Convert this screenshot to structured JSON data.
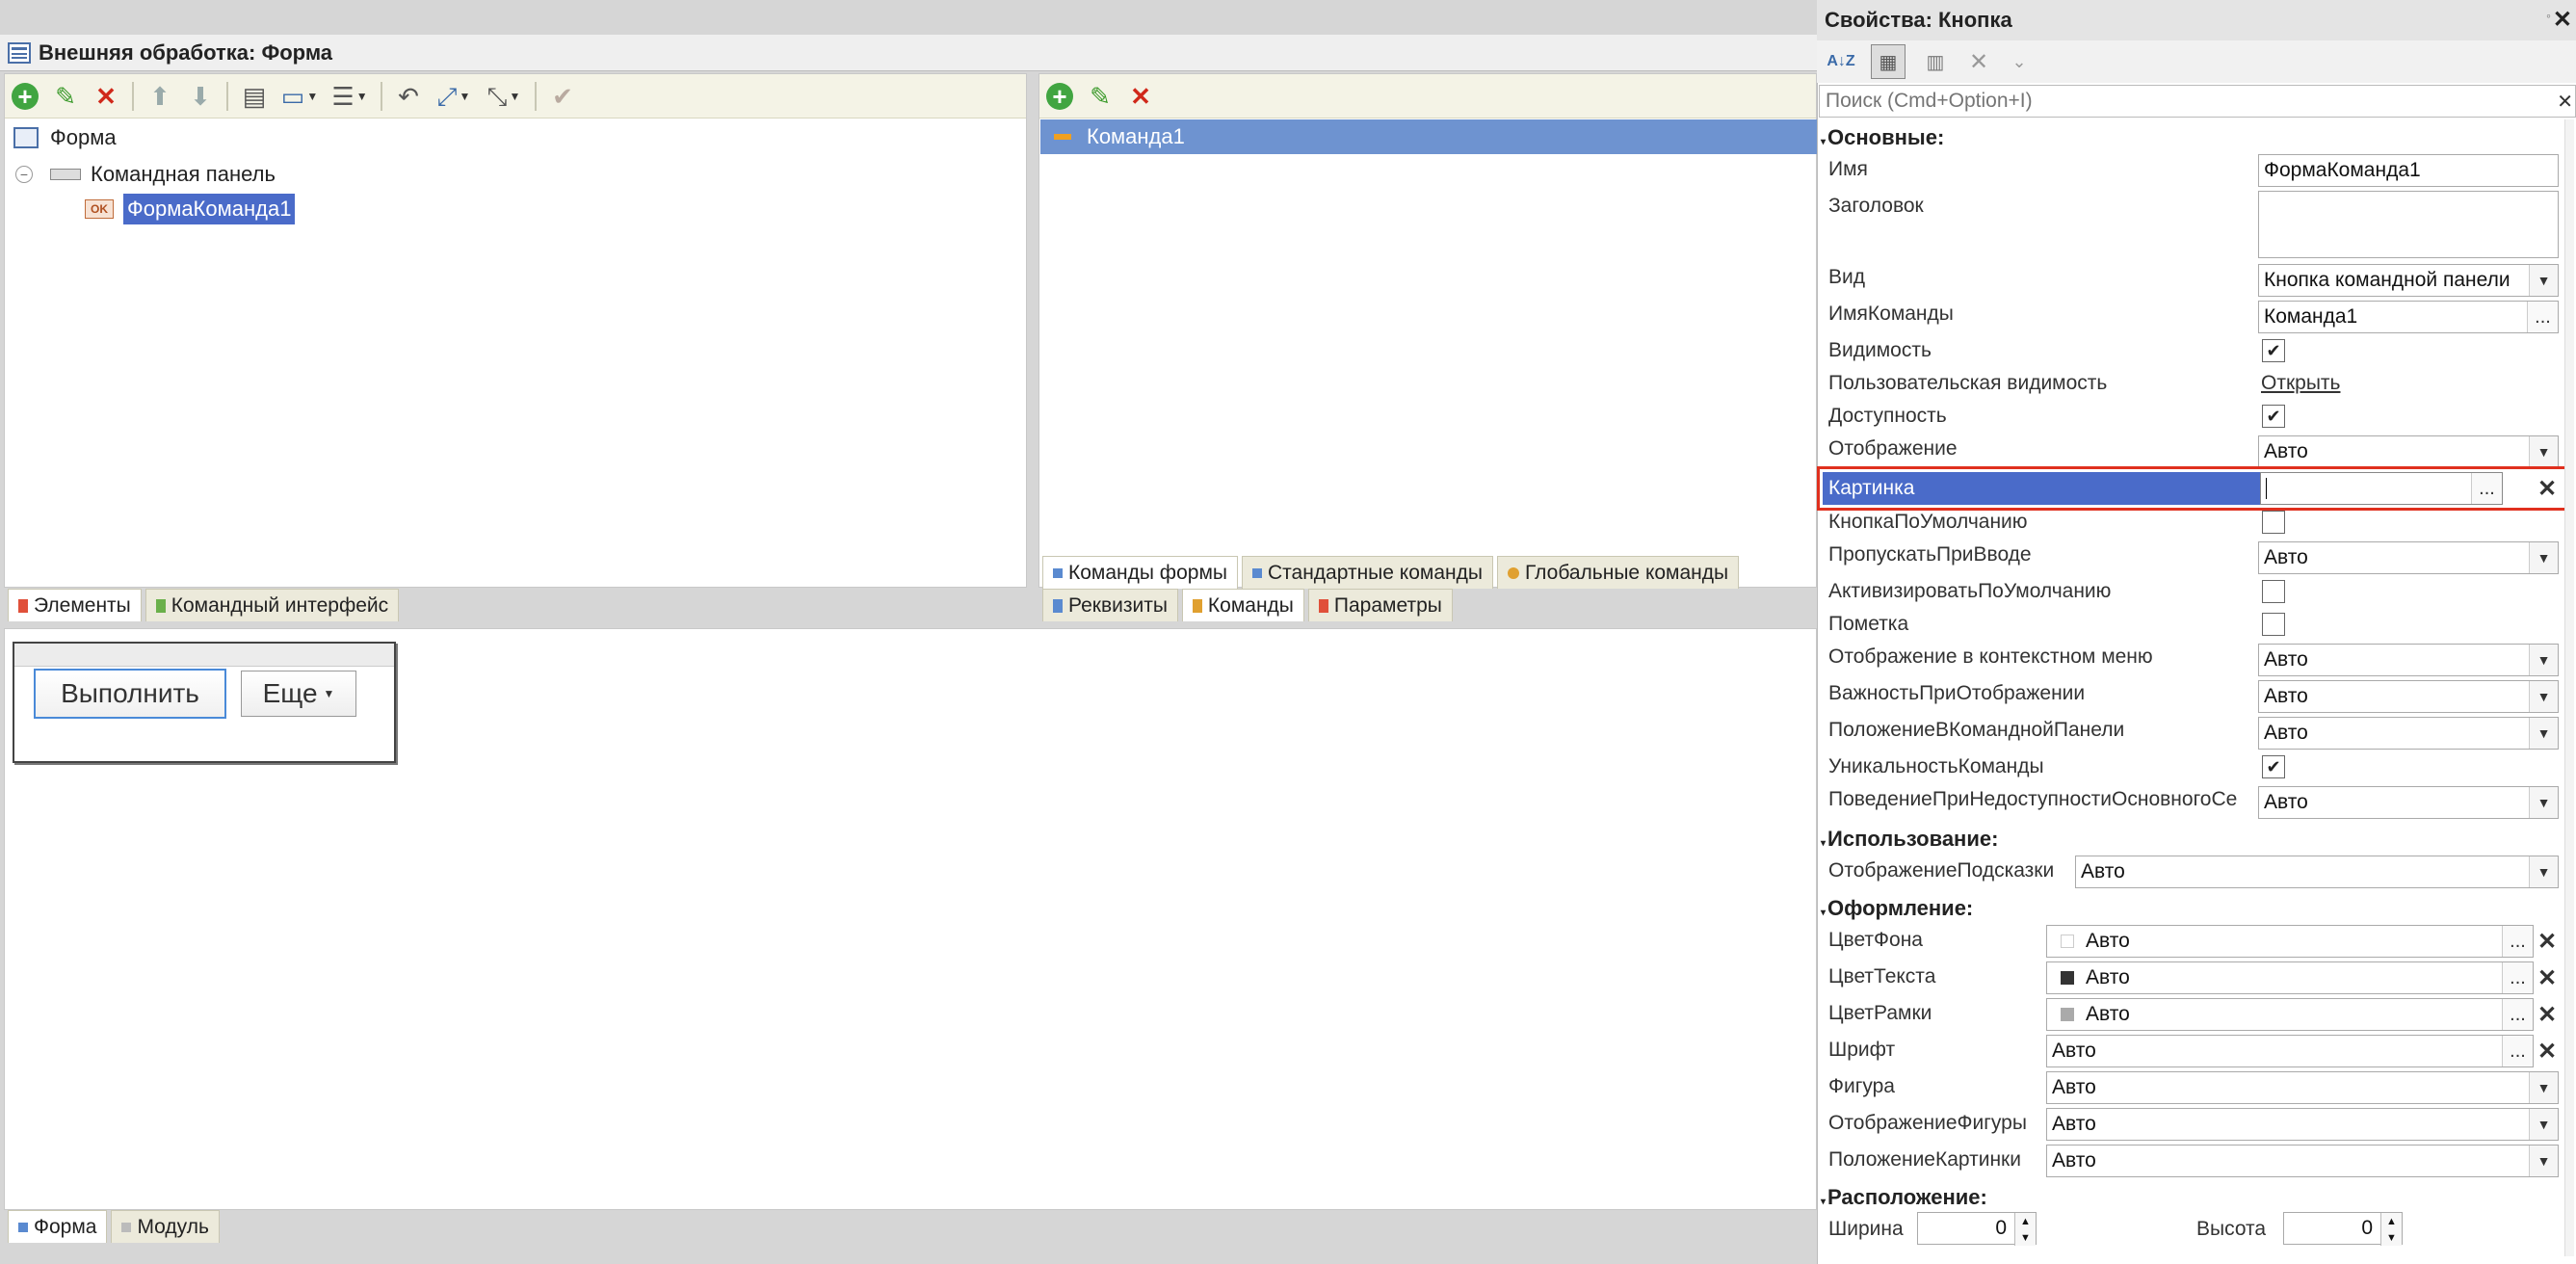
{
  "window": {
    "title": "Внешняя обработка: Форма"
  },
  "tree": {
    "root": "Форма",
    "panel": "Командная панель",
    "button_badge": "OK",
    "button": "ФормаКоманда1"
  },
  "left_tabs": [
    "Элементы",
    "Командный интерфейс"
  ],
  "commands": {
    "item": "Команда1"
  },
  "cmd_tabs_top": [
    "Команды формы",
    "Стандартные команды",
    "Глобальные команды"
  ],
  "cmd_tabs_bottom": [
    "Реквизиты",
    "Команды",
    "Параметры"
  ],
  "preview": {
    "execute": "Выполнить",
    "more": "Еще"
  },
  "bottom_tabs": [
    "Форма",
    "Модуль"
  ],
  "props": {
    "title": "Свойства: Кнопка",
    "search_placeholder": "Поиск (Cmd+Option+I)",
    "sections": {
      "main": "Основные:",
      "usage": "Использование:",
      "design": "Оформление:",
      "layout": "Расположение:"
    },
    "rows": {
      "name": {
        "label": "Имя",
        "value": "ФормаКоманда1"
      },
      "header": {
        "label": "Заголовок",
        "value": ""
      },
      "kind": {
        "label": "Вид",
        "value": "Кнопка командной панели"
      },
      "command_name": {
        "label": "ИмяКоманды",
        "value": "Команда1"
      },
      "visible": {
        "label": "Видимость"
      },
      "user_visible": {
        "label": "Пользовательская видимость",
        "link": "Открыть"
      },
      "enabled": {
        "label": "Доступность"
      },
      "display": {
        "label": "Отображение",
        "value": "Авто"
      },
      "picture": {
        "label": "Картинка",
        "value": ""
      },
      "default_button": {
        "label": "КнопкаПоУмолчанию"
      },
      "skip_on_input": {
        "label": "ПропускатьПриВводе",
        "value": "Авто"
      },
      "activate_default": {
        "label": "АктивизироватьПоУмолчанию"
      },
      "mark": {
        "label": "Пометка"
      },
      "context_menu": {
        "label": "Отображение в контекстном меню",
        "value": "Авто"
      },
      "importance": {
        "label": "ВажностьПриОтображении",
        "value": "Авто"
      },
      "cmd_panel_pos": {
        "label": "ПоложениеВКоманднойПанели",
        "value": "Авто"
      },
      "cmd_unique": {
        "label": "УникальностьКоманды"
      },
      "behavior": {
        "label": "ПоведениеПриНедоступностиОсновногоСе",
        "value": "Авто"
      },
      "tooltip": {
        "label": "ОтображениеПодсказки",
        "value": "Авто"
      },
      "bg_color": {
        "label": "ЦветФона",
        "value": "Авто"
      },
      "text_color": {
        "label": "ЦветТекста",
        "value": "Авто"
      },
      "border_color": {
        "label": "ЦветРамки",
        "value": "Авто"
      },
      "font": {
        "label": "Шрифт",
        "value": "Авто"
      },
      "shape": {
        "label": "Фигура",
        "value": "Авто"
      },
      "shape_display": {
        "label": "ОтображениеФигуры",
        "value": "Авто"
      },
      "picture_pos": {
        "label": "ПоложениеКартинки",
        "value": "Авто"
      },
      "width": {
        "label": "Ширина",
        "value": "0"
      },
      "height": {
        "label": "Высота",
        "value": "0"
      }
    },
    "checkboxes": {
      "visible": true,
      "enabled": true,
      "default_button": false,
      "activate_default": false,
      "mark": false,
      "cmd_unique": true
    }
  },
  "colors": {
    "selection": "#4a6bc9",
    "highlight_border": "#e0301e",
    "toolbar_bg": "#f4f3e6"
  }
}
